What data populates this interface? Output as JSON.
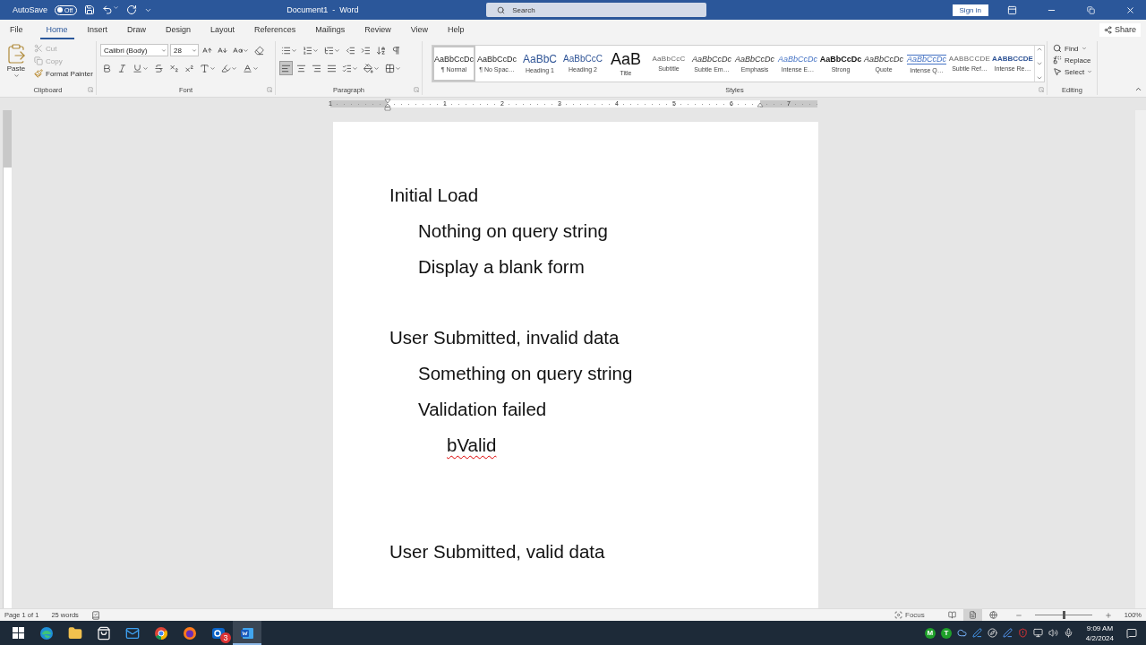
{
  "title_bar": {
    "autosave_label": "AutoSave",
    "autosave_toggle": {
      "label": "Off",
      "on": false
    },
    "title": "Document1  -  Word",
    "search": {
      "placeholder": "Search"
    },
    "sign_in": "Sign in"
  },
  "tabs": [
    {
      "label": "File",
      "selected": false
    },
    {
      "label": "Home",
      "selected": true
    },
    {
      "label": "Insert",
      "selected": false
    },
    {
      "label": "Draw",
      "selected": false
    },
    {
      "label": "Design",
      "selected": false
    },
    {
      "label": "Layout",
      "selected": false
    },
    {
      "label": "References",
      "selected": false
    },
    {
      "label": "Mailings",
      "selected": false
    },
    {
      "label": "Review",
      "selected": false
    },
    {
      "label": "View",
      "selected": false
    },
    {
      "label": "Help",
      "selected": false
    }
  ],
  "share": "Share",
  "ribbon": {
    "clipboard": {
      "label": "Clipboard",
      "paste": "Paste",
      "items": [
        {
          "kind": "cut",
          "label": "Cut",
          "disabled": true
        },
        {
          "kind": "copy",
          "label": "Copy",
          "disabled": true
        },
        {
          "kind": "painter",
          "label": "Format Painter",
          "disabled": false
        }
      ]
    },
    "font": {
      "label": "Font",
      "font_name": "Calibri (Body)",
      "font_size": "28"
    },
    "paragraph": {
      "label": "Paragraph",
      "alignments": [
        {
          "kind": "left",
          "selected": true
        },
        {
          "kind": "center",
          "selected": false
        },
        {
          "kind": "right",
          "selected": false
        },
        {
          "kind": "justify",
          "selected": false
        }
      ]
    },
    "styles": {
      "label": "Styles",
      "items": [
        {
          "sample": "AaBbCcDc",
          "name": "¶ Normal",
          "kind": "normal",
          "selected": true
        },
        {
          "sample": "AaBbCcDc",
          "name": "¶ No Spac…",
          "kind": "normal",
          "selected": false
        },
        {
          "sample": "AaBbC",
          "name": "Heading 1",
          "kind": "heading1",
          "selected": false
        },
        {
          "sample": "AaBbCcC",
          "name": "Heading 2",
          "kind": "heading2",
          "selected": false
        },
        {
          "sample": "AaB",
          "name": "Title",
          "kind": "title",
          "selected": false
        },
        {
          "sample": "AaBbCcC",
          "name": "Subtitle",
          "kind": "subtitle",
          "selected": false
        },
        {
          "sample": "AaBbCcDc",
          "name": "Subtle Em…",
          "kind": "italic",
          "selected": false
        },
        {
          "sample": "AaBbCcDc",
          "name": "Emphasis",
          "kind": "italic",
          "selected": false
        },
        {
          "sample": "AaBbCcDc",
          "name": "Intense E…",
          "kind": "intense",
          "selected": false
        },
        {
          "sample": "AaBbCcDc",
          "name": "Strong",
          "kind": "strong",
          "selected": false
        },
        {
          "sample": "AaBbCcDc",
          "name": "Quote",
          "kind": "italic",
          "selected": false
        },
        {
          "sample": "AaBbCcDc",
          "name": "Intense Q…",
          "kind": "intensequote",
          "selected": false
        },
        {
          "sample": "AABBCCDE",
          "name": "Subtle Ref…",
          "kind": "subtitle",
          "selected": false
        },
        {
          "sample": "AABBCCDE",
          "name": "Intense Re…",
          "kind": "intenseref",
          "selected": false
        }
      ]
    },
    "editing": {
      "label": "Editing",
      "items": [
        {
          "kind": "find",
          "label": "Find"
        },
        {
          "kind": "replace",
          "label": "Replace"
        },
        {
          "kind": "select",
          "label": "Select"
        }
      ]
    }
  },
  "ruler": {
    "labels": [
      "1",
      "1",
      "2",
      "3",
      "4",
      "5",
      "6",
      "7"
    ]
  },
  "document": {
    "sections": [
      {
        "text": "Initial Load",
        "misspelled": false,
        "children": [
          {
            "text": "Nothing on query string",
            "misspelled": false
          },
          {
            "text": "Display a blank form",
            "misspelled": false
          }
        ]
      },
      {
        "text": "User Submitted, invalid data",
        "misspelled": false,
        "children": [
          {
            "text": "Something on query string",
            "misspelled": false
          },
          {
            "text": "Validation failed",
            "misspelled": false,
            "children": [
              {
                "text": "bValid",
                "misspelled": true
              }
            ]
          }
        ]
      },
      {
        "text": "User Submitted, valid data",
        "misspelled": false
      }
    ]
  },
  "status_bar": {
    "page": "Page 1 of 1",
    "words": "25 words",
    "focus": "Focus",
    "views": [
      {
        "kind": "read",
        "selected": false
      },
      {
        "kind": "print",
        "selected": true
      },
      {
        "kind": "web",
        "selected": false
      }
    ],
    "zoom": {
      "level": 0.5,
      "reading": "100%"
    }
  },
  "taskbar": {
    "apps": [
      {
        "kind": "edge",
        "active": false
      },
      {
        "kind": "explorer",
        "active": false
      },
      {
        "kind": "store",
        "active": false
      },
      {
        "kind": "mail",
        "active": false
      },
      {
        "kind": "chrome",
        "active": false
      },
      {
        "kind": "firefox",
        "active": false
      },
      {
        "kind": "outlook",
        "active": false,
        "badge": "3"
      },
      {
        "kind": "word",
        "active": true
      }
    ],
    "tray_letters": [
      "M",
      "T"
    ],
    "time": "9:09 AM",
    "date": "4/2/2024"
  }
}
